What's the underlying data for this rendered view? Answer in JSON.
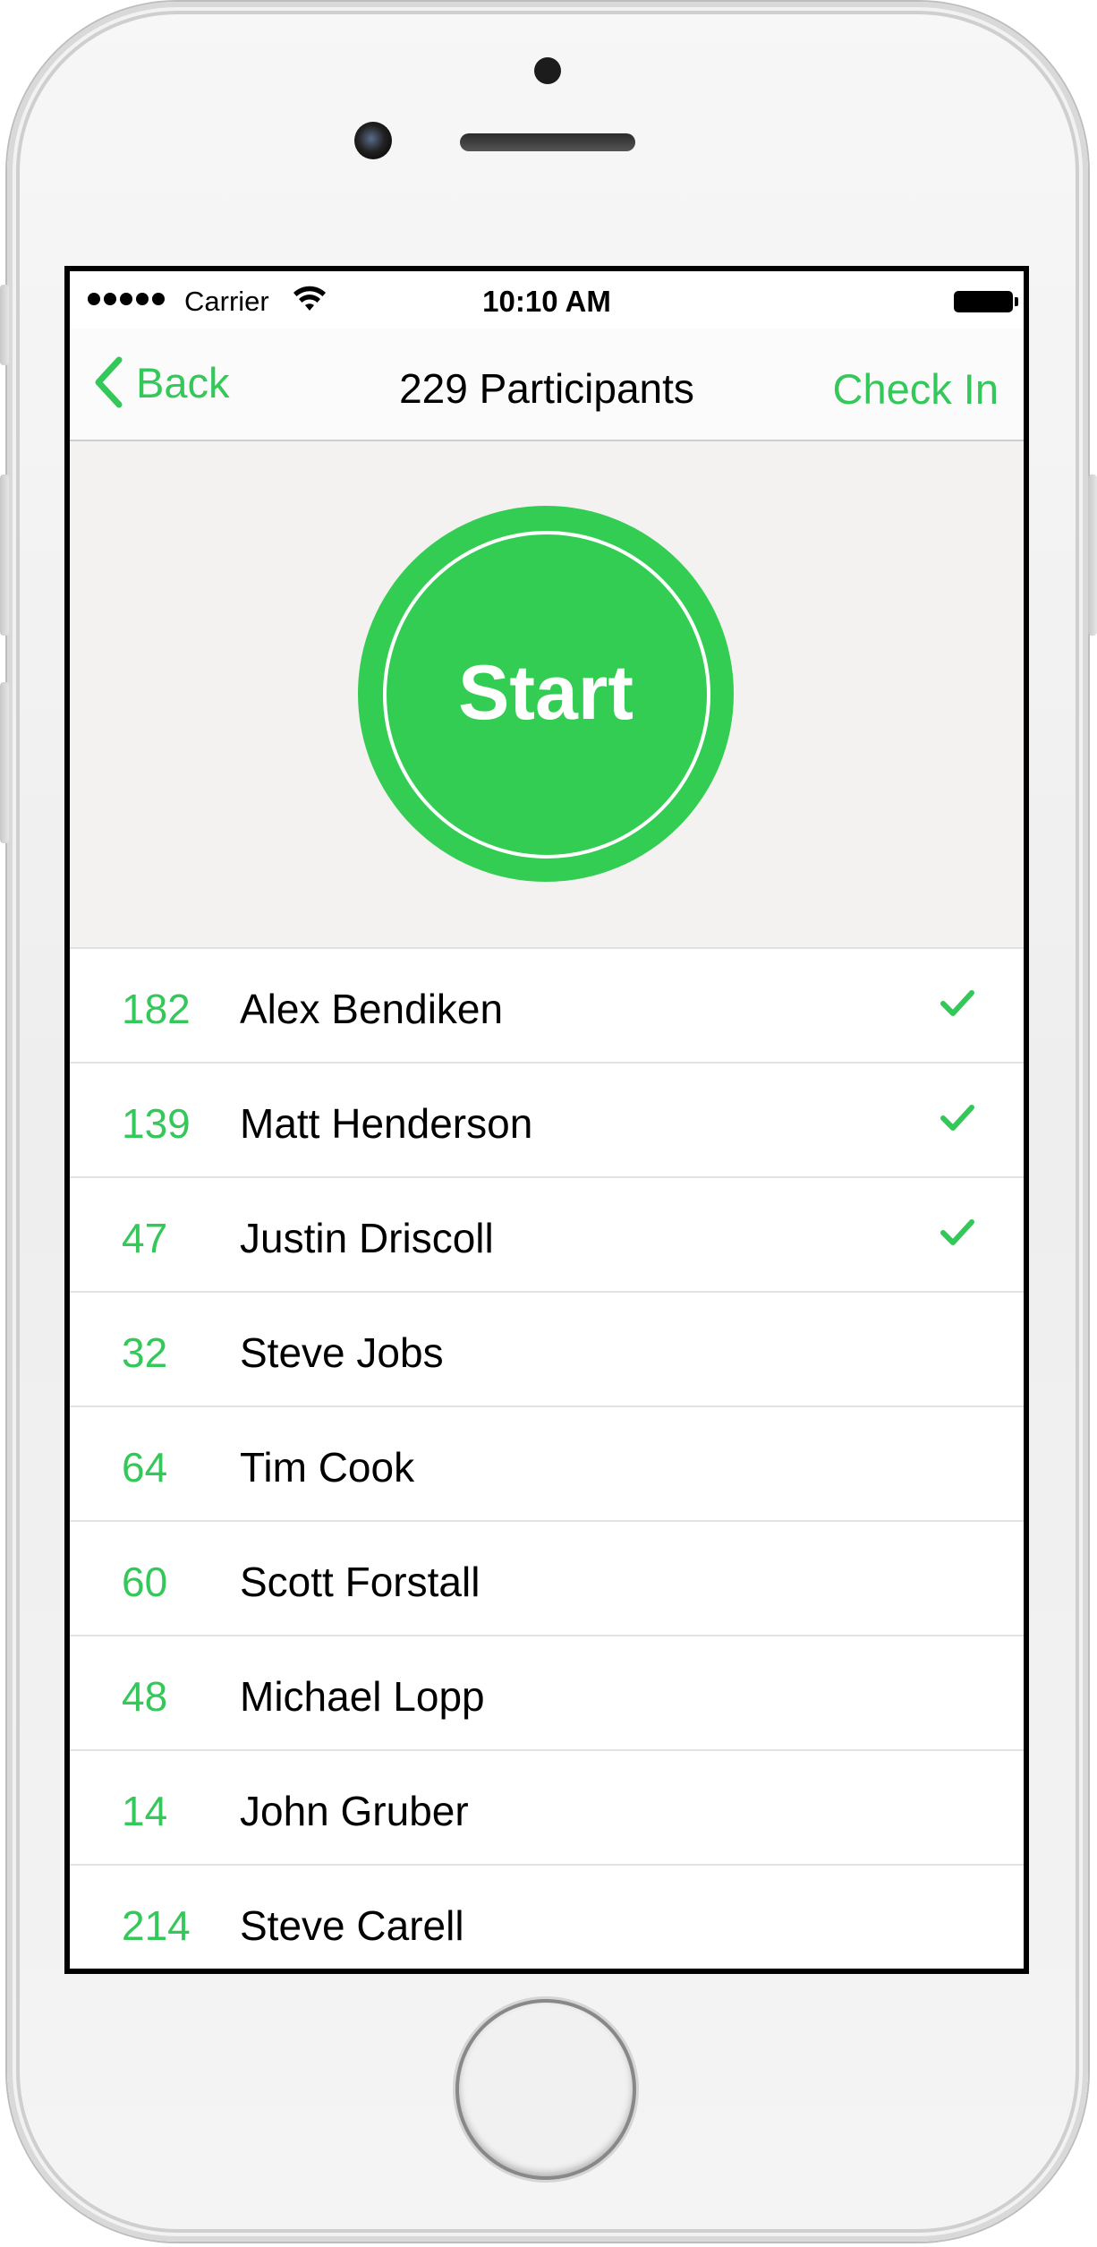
{
  "status_bar": {
    "carrier": "Carrier",
    "time": "10:10 AM"
  },
  "nav": {
    "back_label": "Back",
    "title": "229 Participants",
    "check_in_label": "Check In"
  },
  "hero": {
    "start_label": "Start"
  },
  "colors": {
    "accent": "#34c759",
    "start_fill": "#34cd53",
    "hero_bg": "#f3f2f0"
  },
  "participants": [
    {
      "number": "182",
      "name": "Alex Bendiken",
      "checked": true
    },
    {
      "number": "139",
      "name": "Matt Henderson",
      "checked": true
    },
    {
      "number": "47",
      "name": "Justin Driscoll",
      "checked": true
    },
    {
      "number": "32",
      "name": "Steve Jobs",
      "checked": false
    },
    {
      "number": "64",
      "name": "Tim Cook",
      "checked": false
    },
    {
      "number": "60",
      "name": "Scott Forstall",
      "checked": false
    },
    {
      "number": "48",
      "name": "Michael Lopp",
      "checked": false
    },
    {
      "number": "14",
      "name": "John Gruber",
      "checked": false
    },
    {
      "number": "214",
      "name": "Steve Carell",
      "checked": false
    }
  ]
}
